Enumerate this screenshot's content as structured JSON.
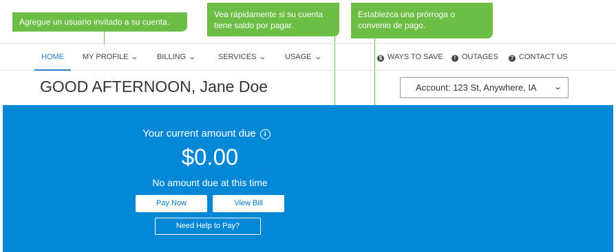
{
  "callouts": [
    "Agregue un usuario invitado a su cuenta.",
    "Vea rápidamente si su cuenta tiene saldo por pagar.",
    "Establezca una prórroga o convenio de pago."
  ],
  "nav": {
    "home": "HOME",
    "my_profile": "MY PROFILE",
    "billing": "BILLING",
    "services": "SERVICES",
    "usage": "USAGE",
    "ways_to_save": "WAYS TO SAVE",
    "outages": "OUTAGES",
    "contact_us": "CONTACT US"
  },
  "greeting": "GOOD AFTERNOON, Jane Doe",
  "account_select": "Account: 123 St, Anywhere, IA",
  "amount_due": {
    "label": "Your current amount due",
    "value": "$0.00",
    "status": "No amount due at this time"
  },
  "buttons": {
    "pay_now": "Pay Now",
    "view_bill": "View Bill",
    "need_help": "Need Help to Pay?"
  },
  "colors": {
    "accent_green": "#6cbe45",
    "hero_blue": "#0288d6",
    "active_blue": "#2a7fc9"
  }
}
